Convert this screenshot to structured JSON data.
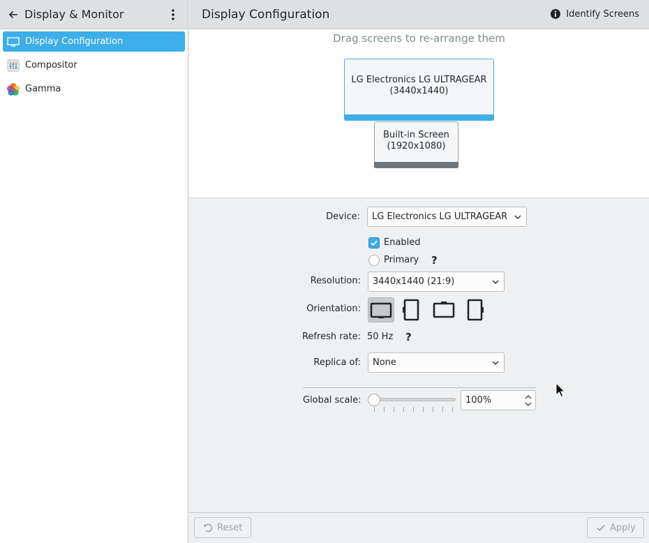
{
  "sidebar": {
    "title": "Display & Monitor",
    "items": [
      {
        "label": "Display Configuration",
        "icon": "monitor-icon",
        "active": true
      },
      {
        "label": "Compositor",
        "icon": "compositor-icon",
        "active": false
      },
      {
        "label": "Gamma",
        "icon": "gamma-icon",
        "active": false
      }
    ]
  },
  "header": {
    "title": "Display Configuration",
    "identify_label": "Identify Screens"
  },
  "screens": {
    "hint": "Drag screens to re-arrange them",
    "monitors": [
      {
        "name": "LG Electronics LG ULTRAGEAR",
        "resolution": "(3440x1440)",
        "selected": true
      },
      {
        "name": "Built-in Screen",
        "resolution": "(1920x1080)",
        "selected": false
      }
    ]
  },
  "form": {
    "device_label": "Device:",
    "device_value": "LG Electronics LG ULTRAGEAR",
    "enabled_label": "Enabled",
    "enabled_checked": true,
    "primary_label": "Primary",
    "primary_checked": false,
    "help_mark": "?",
    "resolution_label": "Resolution:",
    "resolution_value": "3440x1440 (21:9)",
    "orientation_label": "Orientation:",
    "orientation_options": [
      "landscape",
      "portrait",
      "landscape-flipped",
      "portrait-flipped"
    ],
    "orientation_selected": "landscape",
    "refresh_label": "Refresh rate:",
    "refresh_value": "50 Hz",
    "replica_label": "Replica of:",
    "replica_value": "None",
    "scale_label": "Global scale:",
    "scale_value": "100%",
    "scale_fraction": 0.0
  },
  "footer": {
    "reset_label": "Reset",
    "apply_label": "Apply"
  },
  "colors": {
    "accent": "#3daee9",
    "header_bg": "#dee0e2",
    "window_bg": "#eff0f1"
  }
}
